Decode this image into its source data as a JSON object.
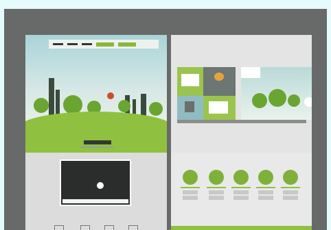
{
  "colors": {
    "frame": "#686969",
    "accent_green": "#8fc03f",
    "dark": "#2a2d2c",
    "tile_blue": "#8fbcc2",
    "tile_gray": "#6c7673"
  },
  "left_page": {
    "nav": {
      "items": [
        "",
        "",
        ""
      ],
      "buttons": [
        "",
        ""
      ]
    },
    "logo_text": "",
    "video": {
      "caption": ""
    }
  },
  "right_page": {
    "tiles": [
      "",
      "",
      "",
      ""
    ],
    "products": [
      {
        "label": ""
      },
      {
        "label": ""
      },
      {
        "label": ""
      },
      {
        "label": ""
      },
      {
        "label": ""
      }
    ]
  }
}
